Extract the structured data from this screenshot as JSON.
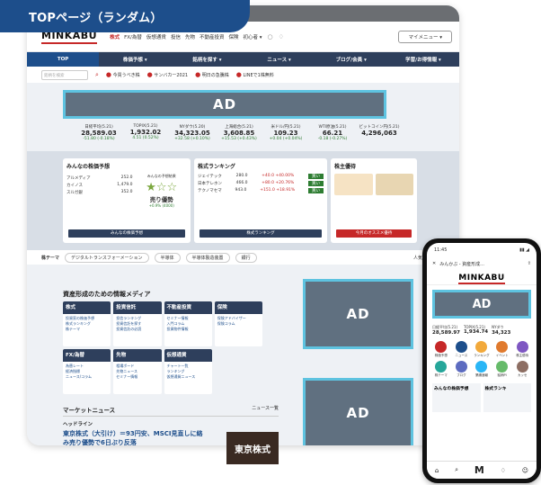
{
  "tag_label": "TOPページ（ランダム）",
  "header": {
    "logo": "MINKABU",
    "links": [
      "株式",
      "FX/為替",
      "仮想通貨",
      "投信",
      "先物",
      "不動産投資",
      "保険",
      "初心者 ▾"
    ],
    "my_menu": "マイメニュー ▾"
  },
  "nav": {
    "items": [
      "TOP",
      "株価予想 ▾",
      "銘柄を探す ▾",
      "ニュース ▾",
      "ブログ/会員 ▾",
      "学習/お得情報 ▾"
    ]
  },
  "search": {
    "placeholder": "銘柄を検索",
    "items": [
      "今買うべき株",
      "サンバカー2021",
      "明日の急騰株",
      "LINEで1株無料"
    ]
  },
  "ad_label": "AD",
  "tickers": [
    {
      "name": "日経平均(5.21)",
      "value": "28,589.03",
      "change": "-51.80 (-0.18%)"
    },
    {
      "name": "TOPIX(5.21)",
      "value": "1,932.02",
      "change": "4.51 (0.52%)"
    },
    {
      "name": "NYダウ(5.20)",
      "value": "34,323.05",
      "change": "+32.58 (+0.10%)"
    },
    {
      "name": "上海総合(5.21)",
      "value": "3,608.85",
      "change": "+15.53 (+0.43%)"
    },
    {
      "name": "米ドル/円(5.21)",
      "value": "109.23",
      "change": "+0.04 (+0.04%)"
    },
    {
      "name": "WTI原油(5.21)",
      "value": "66.21",
      "change": "-0.18 (-0.27%)"
    },
    {
      "name": "ビットコイン円(5.21)",
      "value": "4,296,063",
      "change": ""
    }
  ],
  "cards": {
    "forecast": {
      "title": "みんなの株価予想",
      "rows": [
        {
          "name": "アルメディア",
          "price": "252.0",
          "change": "-22.0 (-8.0%)"
        },
        {
          "name": "カイノス",
          "price": "1,479.0",
          "change": "+65 (+5.70%)"
        },
        {
          "name": "スルガ銀",
          "price": "352.0",
          "change": "-11.0 (-3.0%)"
        }
      ],
      "rating_title": "みんなの予想結果",
      "verdict": "売り優勢",
      "percent": "+0.9% (4000)",
      "button": "みんなの株価予想"
    },
    "ranking": {
      "title": "株式ランキング",
      "rows": [
        {
          "name": "ジェイテック",
          "price": "280.0",
          "change": "+40.0 +40.00%",
          "tag": "買い"
        },
        {
          "name": "日本テレホン",
          "price": "466.0",
          "change": "+80.0 +20.76%",
          "tag": "買い"
        },
        {
          "name": "テクノマセマ",
          "price": "943.0",
          "change": "+151.0 +18.91%",
          "tag": "買い"
        }
      ],
      "button": "株式ランキング"
    },
    "yutai": {
      "title": "株主優待",
      "button": "今月のオススメ優待"
    }
  },
  "themes": {
    "label": "株テーマ",
    "items": [
      "デジタルトランスフォーメーション",
      "半導体",
      "半導体製造装置",
      "銀行"
    ],
    "more": "人気の株テーマ"
  },
  "media": {
    "title": "資産形成のための情報メディア",
    "cells": [
      {
        "head": "株式",
        "links": [
          "投資家の株価予想",
          "株式ランキング",
          "株テーマ"
        ]
      },
      {
        "head": "投資信託",
        "links": [
          "投信ランキング",
          "投資信託を探す",
          "投資信託の必読"
        ]
      },
      {
        "head": "不動産投資",
        "links": [
          "セミナー情報",
          "入門コラム",
          "投資物件情報"
        ]
      },
      {
        "head": "保険",
        "links": [
          "保険アドバイザー",
          "保険コラム"
        ]
      },
      {
        "head": "FX/為替",
        "links": [
          "為替レート",
          "経済指標",
          "ニュース/コラム"
        ]
      },
      {
        "head": "先物",
        "links": [
          "相場ボード",
          "先物ニュース",
          "セミナー情報"
        ]
      },
      {
        "head": "仮想通貨",
        "links": [
          "チャート一覧",
          "ランキング",
          "仮想通貨ニュース"
        ]
      },
      {
        "head": "",
        "links": []
      }
    ]
  },
  "news": {
    "title": "マーケットニュース",
    "more": "ニュース一覧",
    "sub": "ヘッドライン",
    "headline": "東京株式（大引け）＝93円安、MSCI見直しに絡み売り優勢で6日ぶり反落",
    "new_tag": "NEW",
    "image_text": "東京株式"
  },
  "phone": {
    "time": "11:45",
    "url": "みんかぶ - 資産形成...",
    "logo": "MINKABU",
    "tickers": [
      {
        "name": "日経平均(5.21)",
        "value": "28,589.97"
      },
      {
        "name": "TOPIX(5.21)",
        "value": "1,934.74"
      },
      {
        "name": "NYダウ",
        "value": "34,323"
      }
    ],
    "icons": [
      "株価予想",
      "ニュース",
      "ランキング",
      "イベント",
      "株主優待",
      "株テーマ",
      "ブログ",
      "業績速報",
      "銘柄PI",
      "カッセ"
    ],
    "cards": [
      {
        "title": "みんなの株価予想"
      },
      {
        "title": "株式ランキ"
      }
    ]
  },
  "colors": {
    "brand": "#1d4e8b",
    "accent": "#c62828",
    "ad_border": "#5ec3e0",
    "nav": "#2e3f5c"
  }
}
